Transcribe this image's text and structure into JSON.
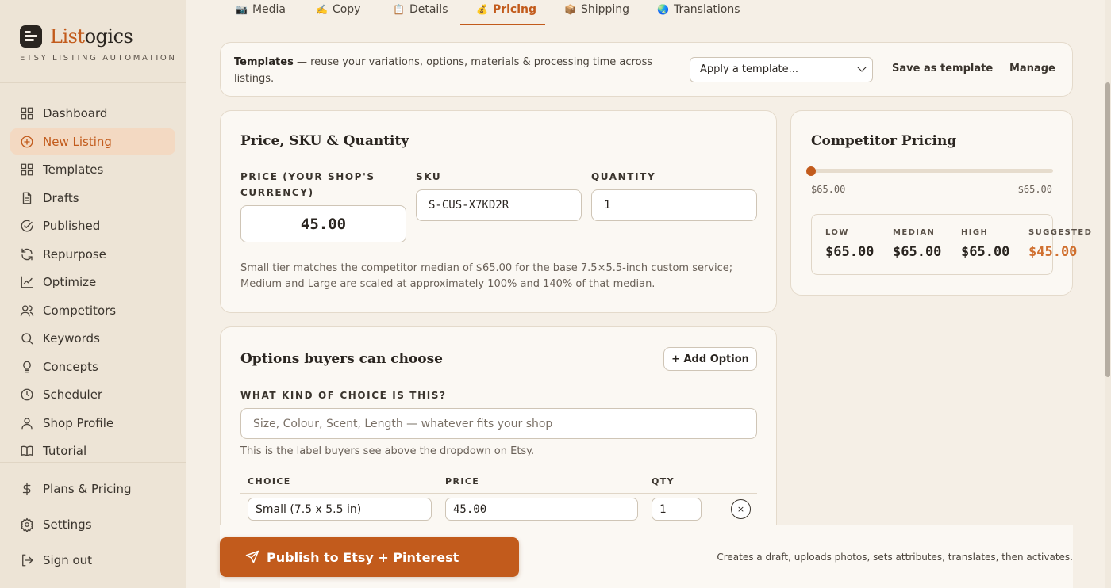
{
  "brand": {
    "title_a": "List",
    "title_b": "ogics",
    "subtitle": "ETSY LISTING AUTOMATION"
  },
  "nav": [
    {
      "label": "Dashboard",
      "icon": "grid-icon"
    },
    {
      "label": "New Listing",
      "icon": "plus-circle-icon",
      "active": true
    },
    {
      "label": "Templates",
      "icon": "grid-icon"
    },
    {
      "label": "Drafts",
      "icon": "document-icon"
    },
    {
      "label": "Published",
      "icon": "check-circle-icon"
    },
    {
      "label": "Repurpose",
      "icon": "refresh-icon"
    },
    {
      "label": "Optimize",
      "icon": "chart-icon"
    },
    {
      "label": "Competitors",
      "icon": "users-icon"
    },
    {
      "label": "Keywords",
      "icon": "search-icon"
    },
    {
      "label": "Concepts",
      "icon": "lightbulb-icon"
    },
    {
      "label": "Scheduler",
      "icon": "clock-icon"
    },
    {
      "label": "Shop Profile",
      "icon": "user-icon"
    },
    {
      "label": "Tutorial",
      "icon": "book-icon"
    }
  ],
  "nav_footer": [
    {
      "label": "Plans & Pricing",
      "icon": "dollar-icon"
    },
    {
      "label": "Settings",
      "icon": "gear-icon"
    },
    {
      "label": "Sign out",
      "icon": "sign-out-icon"
    }
  ],
  "tabs": [
    {
      "label": "Media",
      "icon": "📷"
    },
    {
      "label": "Copy",
      "icon": "✍️"
    },
    {
      "label": "Details",
      "icon": "📋"
    },
    {
      "label": "Pricing",
      "icon": "💰",
      "active": true
    },
    {
      "label": "Shipping",
      "icon": "📦"
    },
    {
      "label": "Translations",
      "icon": "🌏"
    }
  ],
  "templates": {
    "title": "Templates",
    "text": " — reuse your variations, options, materials & processing time across listings.",
    "select_value": "Apply a template...",
    "save_label": "Save as template",
    "manage_label": "Manage"
  },
  "price": {
    "title": "Price, SKU & Quantity",
    "price_label": "PRICE (YOUR SHOP'S CURRENCY)",
    "price_value": "45.00",
    "sku_label": "SKU",
    "sku_value": "S-CUS-X7KD2R",
    "qty_label": "QUANTITY",
    "qty_value": "1",
    "help": "Small tier matches the competitor median of $65.00 for the base 7.5×5.5-inch custom service; Medium and Large are scaled at approximately 100% and 140% of that median."
  },
  "competitor": {
    "title": "Competitor Pricing",
    "range_min": "$65.00",
    "range_max": "$65.00",
    "low_label": "LOW",
    "low": "$65.00",
    "median_label": "MEDIAN",
    "median": "$65.00",
    "high_label": "HIGH",
    "high": "$65.00",
    "suggested_label": "SUGGESTED",
    "suggested": "$45.00",
    "accent": "#c25b1c"
  },
  "options": {
    "title": "Options buyers can choose",
    "add_label": "+ Add Option",
    "kind_label": "WHAT KIND OF CHOICE IS THIS?",
    "kind_placeholder": "Size, Colour, Scent, Length — whatever fits your shop",
    "kind_help": "This is the label buyers see above the dropdown on Etsy.",
    "col_choice": "CHOICE",
    "col_price": "PRICE",
    "col_qty": "QTY",
    "rows": [
      {
        "choice": "Small (7.5 x 5.5 in)",
        "price": "45.00",
        "qty": "1",
        "remove": "×"
      }
    ]
  },
  "publish": {
    "label": "Publish to Etsy + Pinterest",
    "note": "Creates a draft, uploads photos, sets attributes, translates, then activates."
  }
}
